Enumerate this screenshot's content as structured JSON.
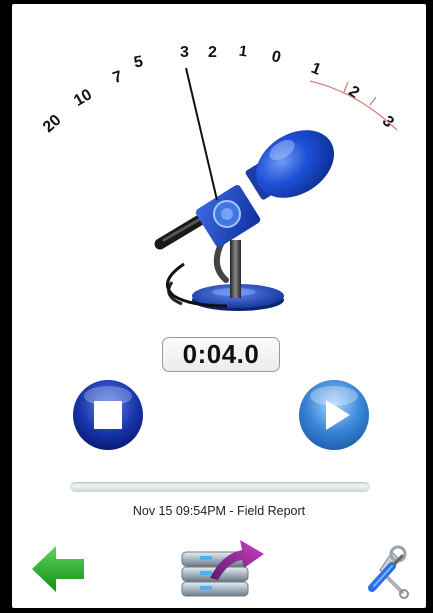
{
  "meter": {
    "scale_labels": [
      "20",
      "10",
      "7",
      "5",
      "3",
      "2",
      "1",
      "0",
      "1",
      "2",
      "3"
    ],
    "scale_colors": {
      "normal": "#111111",
      "peak": "#d9837f"
    },
    "level_db": -3
  },
  "recording": {
    "elapsed": "0:04.0",
    "caption": "Nov 15 09:54PM - Field Report",
    "playback_progress": 0
  },
  "controls": {
    "stop_icon": "stop-icon",
    "play_icon": "play-icon",
    "back_icon": "back-arrow-icon",
    "transfer_icon": "transfer-icon",
    "settings_icon": "settings-tools-icon"
  },
  "colors": {
    "button_blue": "#1633a8",
    "play_blue": "#3a86d6",
    "mic_blue": "#1540c8",
    "arrow_green": "#22a622",
    "transfer_purple": "#a02aa0"
  }
}
